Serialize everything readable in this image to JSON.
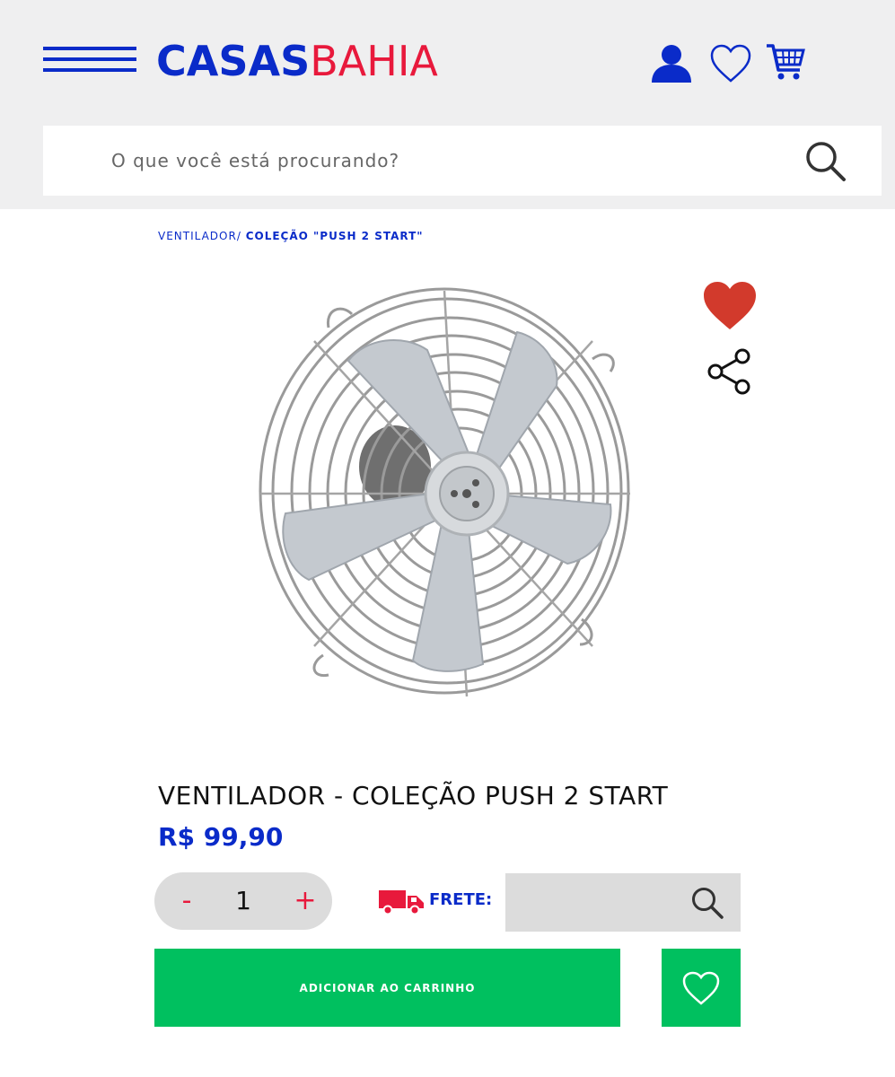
{
  "header": {
    "logo_part1": "CASAS",
    "logo_part2": "BAHIA",
    "brand_blue": "#0a2bc9",
    "brand_red": "#e8193c",
    "icons": [
      "menu-icon",
      "user-icon",
      "heart-outline-icon",
      "cart-icon"
    ]
  },
  "search": {
    "placeholder": "O que você está procurando?",
    "value": ""
  },
  "breadcrumb": {
    "item1": "VENTILADOR/",
    "item2": "COLEÇÃO \"PUSH 2 START\""
  },
  "product": {
    "title": "VENTILADOR - COLEÇÃO PUSH 2 START",
    "price": "R$ 99,90",
    "image": "fan-image",
    "favorited": true
  },
  "quantity": {
    "minus": "-",
    "value": "1",
    "plus": "+"
  },
  "shipping": {
    "label": "FRETE:",
    "value": ""
  },
  "actions": {
    "add_to_cart": "ADICIONAR AO CARRINHO",
    "accent_green": "#00c05f"
  }
}
